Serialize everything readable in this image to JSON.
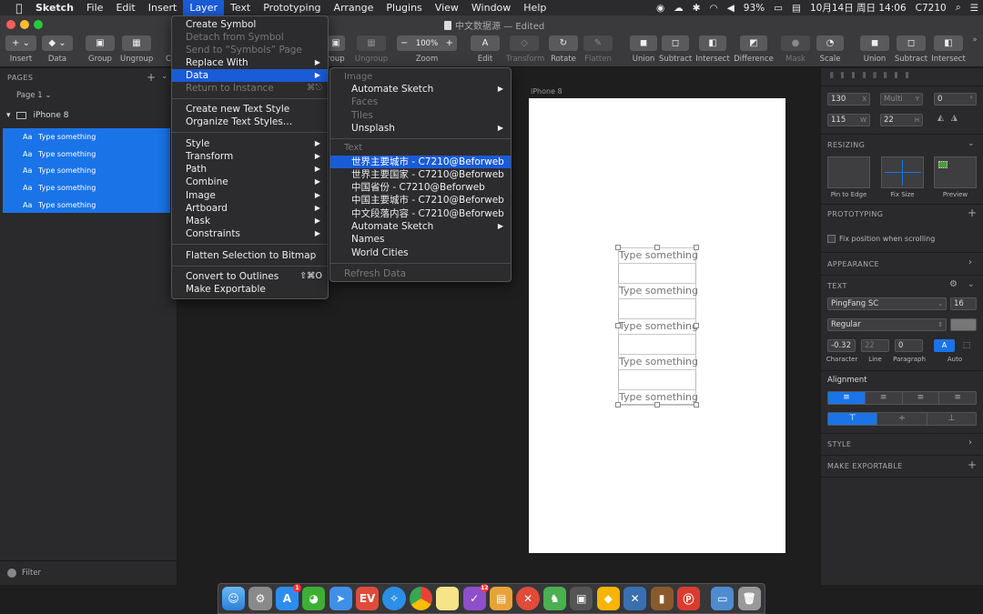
{
  "menubar": {
    "apple": "",
    "items": [
      "Sketch",
      "File",
      "Edit",
      "Insert",
      "Layer",
      "Text",
      "Prototyping",
      "Arrange",
      "Plugins",
      "View",
      "Window",
      "Help"
    ],
    "active": "Layer",
    "right": {
      "battery": "93%",
      "datetime": "10月14日 周日 14:06",
      "user": "C7210"
    }
  },
  "window": {
    "title": "中文数据源",
    "edited": "— Edited"
  },
  "toolbar": {
    "insert": "Insert",
    "data": "Data",
    "group": "Group",
    "ungroup": "Ungroup",
    "create": "C",
    "group2": "roup",
    "ungroup2": "Ungroup",
    "zoom": "Zoom",
    "zoom_value": "100%",
    "edit": "Edit",
    "transform": "Transform",
    "rotate": "Rotate",
    "flatten": "Flatten",
    "union": "Union",
    "subtract": "Subtract",
    "intersect": "Intersect",
    "difference": "Difference",
    "mask": "Mask",
    "scale": "Scale",
    "union2": "Union",
    "subtract2": "Subtract",
    "intersect2": "Intersect"
  },
  "sidebar": {
    "pages_label": "PAGES",
    "page": "Page 1",
    "artboard": "iPhone 8",
    "layers": [
      "Type something",
      "Type something",
      "Type something",
      "Type something",
      "Type something"
    ],
    "layer_icon": "Aa",
    "filter": "Filter"
  },
  "canvas": {
    "artboard_label": "iPhone 8",
    "texts": [
      "Type something",
      "Type something",
      "Type something",
      "Type something",
      "Type something"
    ]
  },
  "layer_menu": {
    "items": [
      {
        "label": "Create Symbol",
        "disabled": false
      },
      {
        "label": "Detach from Symbol",
        "disabled": true
      },
      {
        "label": "Send to “Symbols” Page",
        "disabled": true
      },
      {
        "label": "Replace With",
        "disabled": false,
        "submenu": true
      },
      {
        "label": "Data",
        "disabled": false,
        "submenu": true,
        "highlighted": true
      },
      {
        "label": "Return to Instance",
        "disabled": true,
        "shortcut": "⌘⎋"
      },
      {
        "label": "Create new Text Style",
        "disabled": false
      },
      {
        "label": "Organize Text Styles…",
        "disabled": false
      },
      {
        "label": "Style",
        "submenu": true
      },
      {
        "label": "Transform",
        "submenu": true
      },
      {
        "label": "Path",
        "submenu": true
      },
      {
        "label": "Combine",
        "submenu": true
      },
      {
        "label": "Image",
        "submenu": true
      },
      {
        "label": "Artboard",
        "submenu": true
      },
      {
        "label": "Mask",
        "submenu": true
      },
      {
        "label": "Constraints",
        "submenu": true
      },
      {
        "label": "Flatten Selection to Bitmap"
      },
      {
        "label": "Convert to Outlines",
        "shortcut": "⇧⌘O"
      },
      {
        "label": "Make Exportable"
      }
    ]
  },
  "data_menu": {
    "image_header": "Image",
    "image_items": [
      {
        "label": "Automate Sketch",
        "submenu": true
      },
      {
        "label": "Faces",
        "disabled": true
      },
      {
        "label": "Tiles",
        "disabled": true
      },
      {
        "label": "Unsplash",
        "submenu": true
      }
    ],
    "text_header": "Text",
    "text_items": [
      {
        "label": "世界主要城市 - C7210@Beforweb",
        "highlighted": true
      },
      {
        "label": "世界主要国家 - C7210@Beforweb"
      },
      {
        "label": "中国省份 - C7210@Beforweb"
      },
      {
        "label": "中国主要城市 - C7210@Beforweb"
      },
      {
        "label": "中文段落内容 - C7210@Beforweb"
      },
      {
        "label": "Automate Sketch",
        "submenu": true
      },
      {
        "label": "Names"
      },
      {
        "label": "World Cities"
      }
    ],
    "refresh": "Refresh Data"
  },
  "inspector": {
    "x": "130",
    "x_suffix": "X",
    "y": "Multi",
    "y_suffix": "Y",
    "rot": "0",
    "rot_suffix": "°",
    "w": "115",
    "w_suffix": "W",
    "h": "22",
    "h_suffix": "H",
    "resizing": "RESIZING",
    "pin_to_edge": "Pin to Edge",
    "fix_size": "Fix Size",
    "preview": "Preview",
    "prototyping": "PROTOTYPING",
    "fix_scroll": "Fix position when scrolling",
    "appearance": "APPEARANCE",
    "text": "TEXT",
    "font": "PingFang SC",
    "font_size": "16",
    "weight": "Regular",
    "character": "-0.32",
    "line": "22",
    "paragraph": "0",
    "character_label": "Character",
    "line_label": "Line",
    "paragraph_label": "Paragraph",
    "auto_label": "Auto",
    "alignment": "Alignment",
    "style": "STYLE",
    "make_exportable": "MAKE EXPORTABLE",
    "accent": "#1a74e8"
  },
  "dock": {
    "icons": [
      "finder-icon",
      "system-preferences-icon",
      "app-store-icon",
      "wechat-icon",
      "paper-plane-icon",
      "ev-icon",
      "safari-icon",
      "chrome-icon",
      "notes-icon",
      "omnifocus-icon",
      "sketchbook-icon",
      "close-x-icon",
      "evernote-icon",
      "screenshot-icon",
      "sketch-icon",
      "xcode-icon",
      "keynote-icon",
      "ps-icon",
      "folder-icon",
      "trash-icon"
    ],
    "badges": {
      "app-store-icon": "1",
      "omnifocus-icon": "12"
    }
  }
}
